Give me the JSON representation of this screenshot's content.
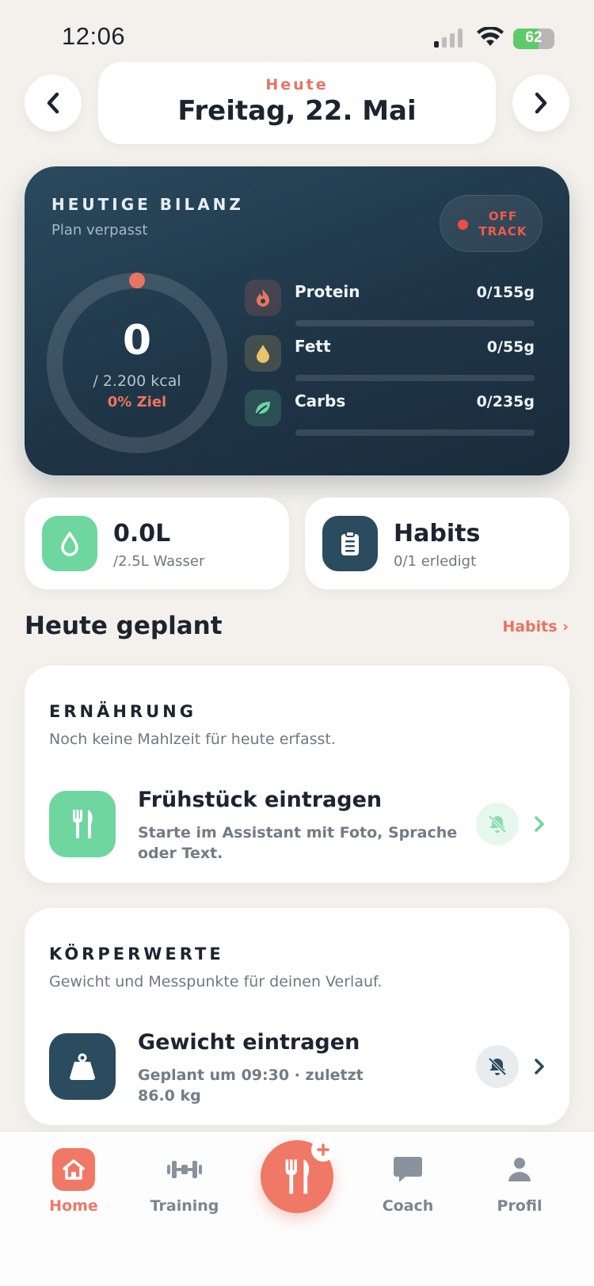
{
  "status_bar": {
    "time": "12:06",
    "battery": "62",
    "battery_level": 0.62
  },
  "header": {
    "sub": "Heute",
    "date": "Freitag, 22. Mai"
  },
  "bilanz": {
    "title": "HEUTIGE BILANZ",
    "subtitle": "Plan verpasst",
    "status_line1": "OFF",
    "status_line2": "TRACK",
    "kcal_value": "0",
    "kcal_goal": "/ 2.200 kcal",
    "kcal_pct": "0% Ziel",
    "kcal_progress": 0,
    "macros": [
      {
        "label": "Protein",
        "value": "0/155g",
        "progress": 0,
        "icon": "flame-icon",
        "color": "#e97462"
      },
      {
        "label": "Fett",
        "value": "0/55g",
        "progress": 0,
        "icon": "drop-icon",
        "color": "#e8c46a"
      },
      {
        "label": "Carbs",
        "value": "0/235g",
        "progress": 0,
        "icon": "leaf-icon",
        "color": "#6fd19d"
      }
    ]
  },
  "water": {
    "value": "0.0L",
    "sub": "/2.5L Wasser",
    "icon": "water-drop-icon",
    "color": "#6fd6a0"
  },
  "habits": {
    "value": "Habits",
    "sub": "0/1 erledigt",
    "icon": "clipboard-icon",
    "color": "#2b4b5f"
  },
  "section": {
    "title": "Heute geplant",
    "link": "Habits ›"
  },
  "nutrition": {
    "head": "ERNÄHRUNG",
    "desc": "Noch keine Mahlzeit für heute erfasst.",
    "item_title": "Frühstück eintragen",
    "item_text": "Starte im Assistant mit Foto, Sprache oder Text.",
    "icon": "fork-knife-icon",
    "color": "#6fd6a0"
  },
  "body_values": {
    "head": "KÖRPERWERTE",
    "desc": "Gewicht und Messpunkte für deinen Verlauf.",
    "item_title": "Gewicht eintragen",
    "item_text": "Geplant um 09:30 · zuletzt 86.0 kg",
    "icon": "weight-icon",
    "color": "#2b4b5f"
  },
  "tabs": [
    {
      "label": "Home",
      "icon": "home-icon",
      "active": true
    },
    {
      "label": "Training",
      "icon": "dumbbell-icon",
      "active": false
    },
    {
      "label": "Coach",
      "icon": "chat-icon",
      "active": false
    },
    {
      "label": "Profil",
      "icon": "user-icon",
      "active": false
    }
  ],
  "colors": {
    "accent": "#ef7866",
    "dark": "#1e3547",
    "mint": "#6fd6a0",
    "background": "#f4f1ec"
  }
}
